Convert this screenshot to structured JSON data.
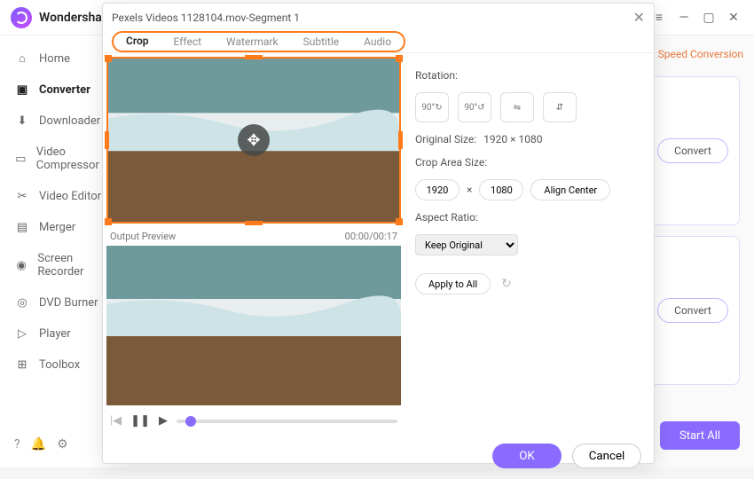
{
  "app": {
    "name": "Wondershare"
  },
  "window": {
    "menu": "≡",
    "min": "—",
    "max": "▢",
    "close": "✕"
  },
  "sidebar": {
    "items": [
      {
        "label": "Home",
        "icon": "⌂"
      },
      {
        "label": "Converter",
        "icon": "▣"
      },
      {
        "label": "Downloader",
        "icon": "⬇"
      },
      {
        "label": "Video Compressor",
        "icon": "▭"
      },
      {
        "label": "Video Editor",
        "icon": "✂"
      },
      {
        "label": "Merger",
        "icon": "▤"
      },
      {
        "label": "Screen Recorder",
        "icon": "◉"
      },
      {
        "label": "DVD Burner",
        "icon": "◎"
      },
      {
        "label": "Player",
        "icon": "▷"
      },
      {
        "label": "Toolbox",
        "icon": "⊞"
      }
    ],
    "bottom": {
      "help": "?",
      "bell": "🔔",
      "settings": "⚙"
    }
  },
  "main": {
    "speed": "Speed Conversion",
    "convert": "Convert",
    "start_all": "Start All"
  },
  "dialog": {
    "title": "Pexels Videos 1128104.mov-Segment 1",
    "tabs": [
      "Crop",
      "Effect",
      "Watermark",
      "Subtitle",
      "Audio"
    ],
    "preview_label": "Output Preview",
    "timecode": "00:00/00:17",
    "rotation_label": "Rotation:",
    "rot_buttons": [
      "90°↻",
      "90°↺",
      "⇋",
      "⇵"
    ],
    "orig_size_label": "Original Size:",
    "orig_size": "1920 × 1080",
    "crop_size_label": "Crop Area Size:",
    "crop_w": "1920",
    "x": "×",
    "crop_h": "1080",
    "align_center": "Align Center",
    "aspect_label": "Aspect Ratio:",
    "aspect_value": "Keep Original",
    "apply_all": "Apply to All",
    "refresh": "↻",
    "ok": "OK",
    "cancel": "Cancel",
    "player": {
      "prev": "|◀",
      "pause": "❚❚",
      "play": "▶"
    }
  }
}
